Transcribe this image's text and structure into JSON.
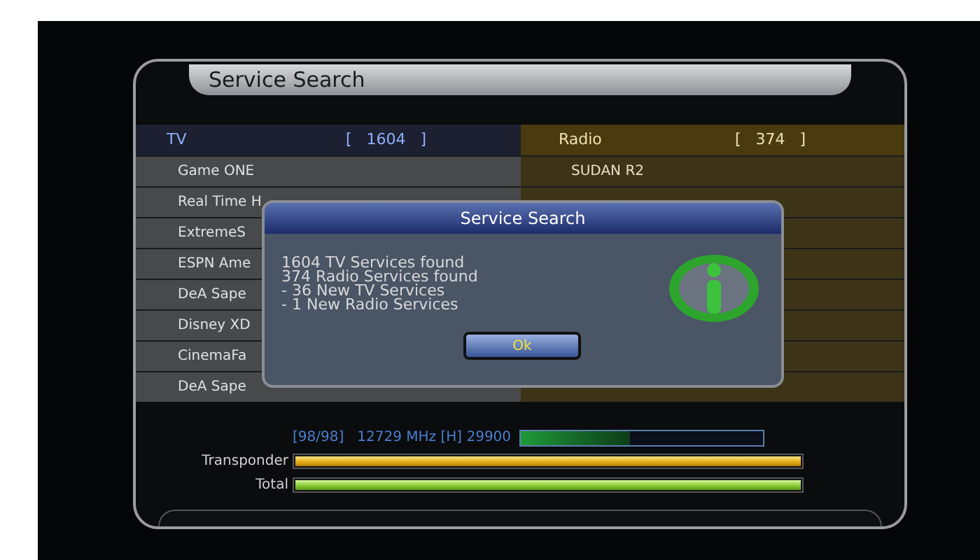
{
  "screen": {
    "title": "Service Search"
  },
  "tv": {
    "label": "TV",
    "count": "[   1604   ]",
    "rows": [
      "Game ONE",
      "Real Time H",
      "ExtremeS",
      "ESPN Ame",
      "DeA Sape",
      "Disney XD",
      "CinemaFa",
      "DeA Sape"
    ]
  },
  "radio": {
    "label": "Radio",
    "count": "[   374   ]",
    "rows": [
      "SUDAN R2"
    ]
  },
  "dialog": {
    "title": "Service Search",
    "lines": [
      "1604 TV Services found",
      "374 Radio Services found",
      "- 36 New TV Services",
      "- 1 New Radio Services"
    ],
    "button": "Ok"
  },
  "progress": {
    "transponder_info": "[98/98]   12729 MHz [H] 29900",
    "signal": {
      "level": 0.45
    },
    "bars": [
      {
        "label": "Transponder",
        "kind": "transponder",
        "level": 1
      },
      {
        "label": "Total",
        "kind": "total",
        "level": 1
      }
    ]
  }
}
